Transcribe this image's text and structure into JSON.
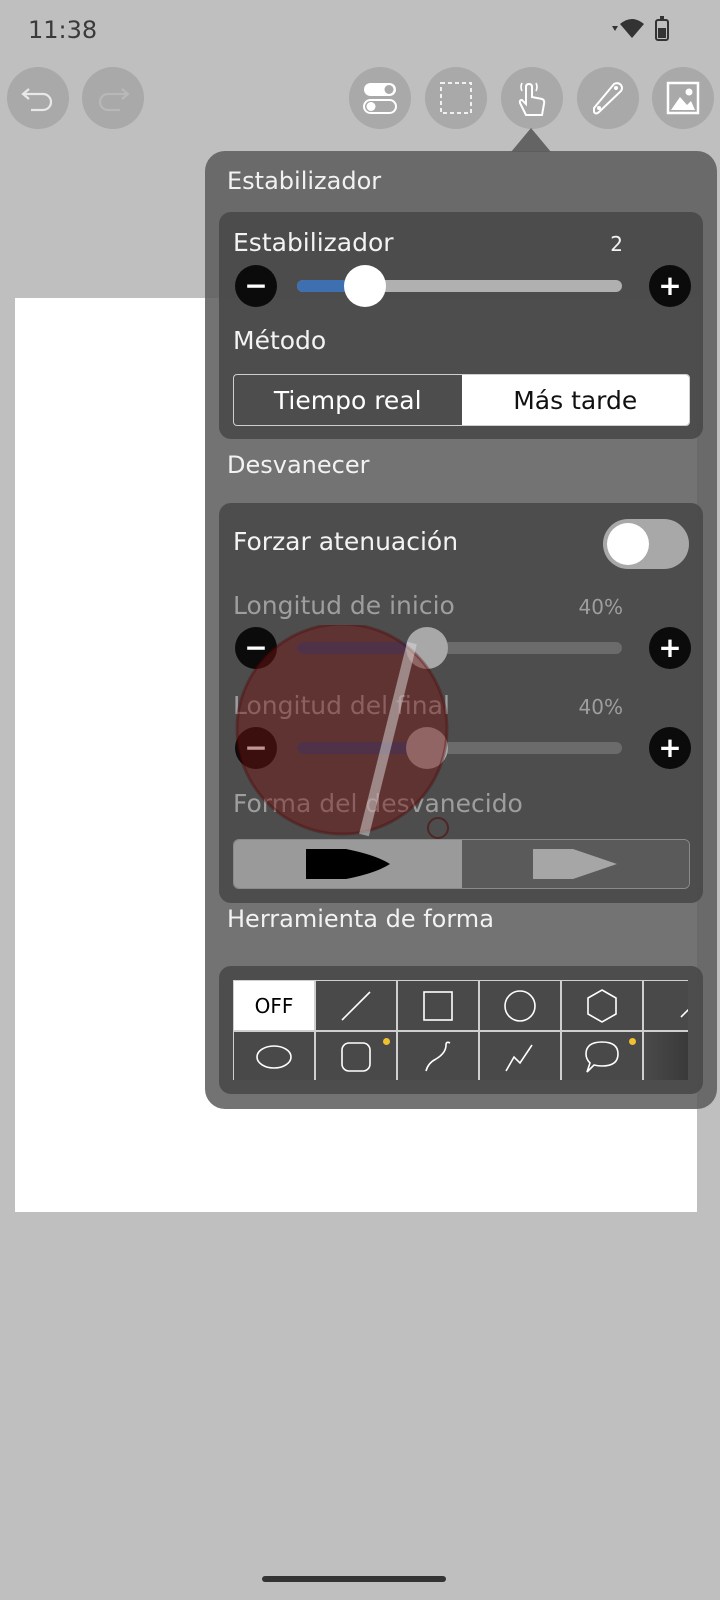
{
  "status": {
    "time": "11:38"
  },
  "toolbar": {
    "buttons": [
      "undo-icon",
      "redo-icon",
      "toggle-settings-icon",
      "selection-icon",
      "hand-gesture-icon",
      "ruler-icon",
      "image-icon"
    ]
  },
  "popup": {
    "stabilizer_section": "Estabilizador",
    "stabilizer": {
      "label": "Estabilizador",
      "value": "2",
      "level": 0.21
    },
    "method": {
      "label": "Método",
      "options": [
        "Tiempo real",
        "Más tarde"
      ],
      "selected": "Más tarde"
    },
    "fade_section": "Desvanecer",
    "force_fade": {
      "label": "Forzar atenuación",
      "on": false
    },
    "start_length": {
      "label": "Longitud de inicio",
      "value": "40%",
      "level": 0.4
    },
    "end_length": {
      "label": "Longitud del final",
      "value": "40%",
      "level": 0.4
    },
    "fade_shape": {
      "label": "Forma del desvanecido"
    },
    "shape_section": "Herramienta de forma",
    "shape_tool": {
      "off_label": "OFF",
      "row1": [
        "line-icon",
        "rectangle-icon",
        "circle-icon",
        "hexagon-icon",
        "arc-icon"
      ],
      "row2": [
        "ellipse-icon",
        "rounded-rect-icon",
        "curve-icon",
        "polyline-icon",
        "speech-bubble-icon",
        "more-icon"
      ]
    }
  },
  "colors": {
    "accent": "#3e6fb0",
    "indicator_dot": "#f0c030"
  }
}
